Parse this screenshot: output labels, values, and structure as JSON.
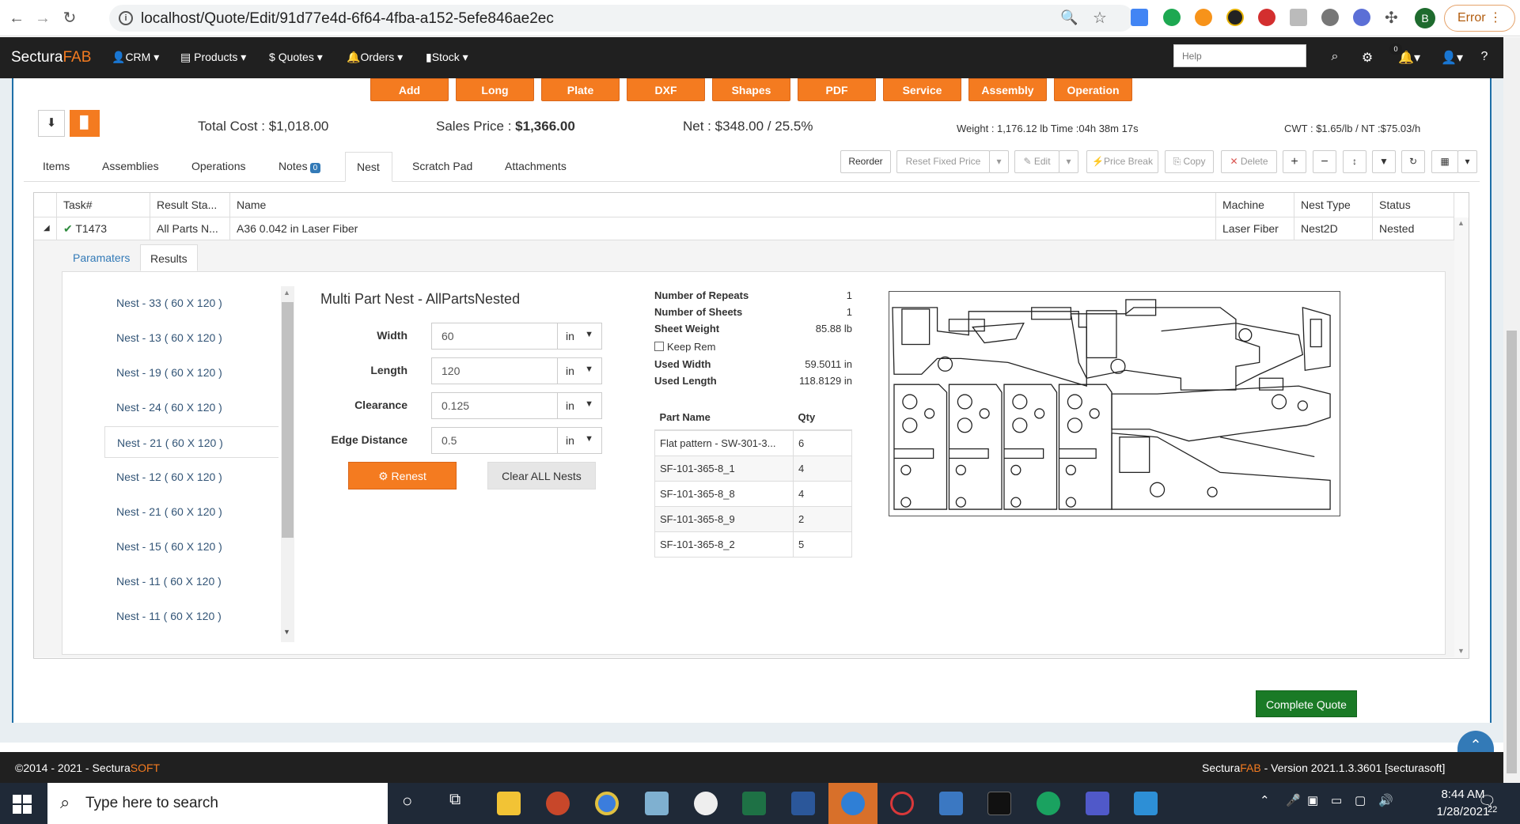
{
  "browser": {
    "url": "localhost/Quote/Edit/91d77e4d-6f64-4fba-a152-5efe846ae2ec",
    "error_label": "Error",
    "avatar_initial": "B"
  },
  "navbar": {
    "brand_prefix": "Sectura",
    "brand_suffix": "FAB",
    "menus": [
      "CRM",
      "Products",
      "Quotes",
      "Orders",
      "Stock"
    ],
    "help_placeholder": "Help",
    "notif_count": "0"
  },
  "actions": [
    "Add",
    "Long",
    "Plate",
    "DXF",
    "Shapes",
    "PDF",
    "Service",
    "Assembly",
    "Operation"
  ],
  "summary": {
    "total_cost": "Total Cost : $1,018.00",
    "sales_label": "Sales Price : ",
    "sales_value": "$1,366.00",
    "net": "Net : $348.00 / 25.5%",
    "weight_time": "Weight : 1,176.12 lb Time :04h 38m 17s",
    "cwt": "CWT : $1.65/lb / NT :$75.03/h"
  },
  "tabs": {
    "items": "Items",
    "assemblies": "Assemblies",
    "operations": "Operations",
    "notes": "Notes",
    "notes_count": "0",
    "nest": "Nest",
    "scratch": "Scratch Pad",
    "attachments": "Attachments"
  },
  "toolbar": {
    "reorder": "Reorder",
    "reset_fixed": "Reset Fixed Price",
    "edit": "Edit",
    "price_break": "Price Break",
    "copy": "Copy",
    "delete": "Delete"
  },
  "grid": {
    "headers": [
      "Task#",
      "Result Sta...",
      "Name",
      "Machine",
      "Nest Type",
      "Status"
    ],
    "row": {
      "task": "T1473",
      "result": "All Parts N...",
      "name": "A36 0.042 in Laser Fiber",
      "machine": "Laser Fiber",
      "nest_type": "Nest2D",
      "status": "Nested"
    }
  },
  "subtabs": {
    "params": "Paramaters",
    "results": "Results"
  },
  "nests": [
    "Nest - 33 ( 60 X 120 )",
    "Nest - 13 ( 60 X 120 )",
    "Nest - 19 ( 60 X 120 )",
    "Nest - 24 ( 60 X 120 )",
    "Nest - 21 ( 60 X 120 )",
    "Nest - 12 ( 60 X 120 )",
    "Nest - 21 ( 60 X 120 )",
    "Nest - 15 ( 60 X 120 )",
    "Nest - 11 ( 60 X 120 )",
    "Nest - 11 ( 60 X 120 )"
  ],
  "form": {
    "title": "Multi Part Nest - AllPartsNested",
    "width_label": "Width",
    "width_value": "60",
    "width_unit": "in",
    "length_label": "Length",
    "length_value": "120",
    "length_unit": "in",
    "clearance_label": "Clearance",
    "clearance_value": "0.125",
    "clearance_unit": "in",
    "edge_label": "Edge Distance",
    "edge_value": "0.5",
    "edge_unit": "in",
    "renest": "Renest",
    "clear_all": "Clear ALL Nests"
  },
  "stats": {
    "repeats_label": "Number of Repeats",
    "repeats": "1",
    "sheets_label": "Number of Sheets",
    "sheets": "1",
    "sheet_weight_label": "Sheet Weight",
    "sheet_weight": "85.88 lb",
    "keep_rem": "Keep Rem",
    "used_width_label": "Used Width",
    "used_width": "59.5011 in",
    "used_length_label": "Used Length",
    "used_length": "118.8129 in"
  },
  "parts": {
    "headers": [
      "Part Name",
      "Qty"
    ],
    "rows": [
      [
        "Flat pattern - SW-301-3...",
        "6"
      ],
      [
        "SF-101-365-8_1",
        "4"
      ],
      [
        "SF-101-365-8_8",
        "4"
      ],
      [
        "SF-101-365-8_9",
        "2"
      ],
      [
        "SF-101-365-8_2",
        "5"
      ]
    ]
  },
  "footer": {
    "copyright_prefix": "©2014 - 2021 - Sectura",
    "copyright_suffix": "SOFT",
    "complete_quote": "Complete Quote",
    "version_prefix": "Sectura",
    "version_fab": "FAB",
    "version_rest": " - Version 2021.1.3.3601 [secturasoft]"
  },
  "taskbar": {
    "search_placeholder": "Type here to search",
    "time": "8:44 AM",
    "date": "1/28/2021",
    "notif_count": "22"
  }
}
